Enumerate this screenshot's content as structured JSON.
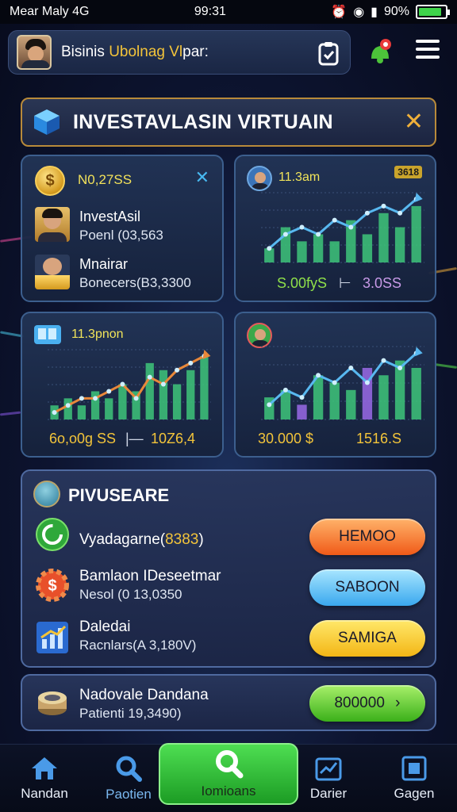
{
  "status_bar": {
    "carrier": "Mear Maly 4G",
    "time": "99:31",
    "battery": "90%"
  },
  "header": {
    "title_plain": "Bisinis ",
    "title_highlight": "Ubolnag Vl",
    "title_end": "par:"
  },
  "banner": {
    "title": "INVESTAVLASIN VIRTUAIN",
    "close": "✕"
  },
  "portfolio": {
    "coin_symbol": "$",
    "total": "N0,27SS",
    "close": "✕",
    "items": [
      {
        "name": "InvestAsil",
        "detail": "Poenl (03,563"
      },
      {
        "name": "Mnairar",
        "detail": "Bonecers(B3,3300"
      }
    ]
  },
  "chart1": {
    "label": "11.3am",
    "tag": "3618",
    "foot_left": "S.00fyS",
    "foot_sep": "⊢",
    "foot_right": "3.0SS",
    "colors": {
      "foot_left": "#8fe04a",
      "foot_right": "#c89ae8"
    },
    "chart_data": {
      "type": "bar",
      "values": [
        2,
        5,
        3,
        4,
        3,
        6,
        4,
        7,
        5,
        8
      ],
      "line": [
        2,
        4,
        5,
        4,
        6,
        5,
        7,
        8,
        7,
        9
      ]
    }
  },
  "chart2": {
    "label": "11.3pnon",
    "foot_left": "6o,o0g SS",
    "foot_sep": "|—",
    "foot_right": "10Z6,4",
    "colors": {
      "foot_left": "#f3c43a",
      "foot_right": "#f3c43a"
    },
    "chart_data": {
      "type": "bar",
      "values": [
        2,
        3,
        2,
        4,
        3,
        5,
        4,
        8,
        7,
        5,
        7,
        9
      ],
      "line": [
        1,
        2,
        3,
        3,
        4,
        5,
        3,
        6,
        5,
        7,
        8,
        9
      ]
    }
  },
  "chart3": {
    "foot_left": "30.000 $",
    "foot_right": "1516.S",
    "colors": {
      "foot_left": "#f3c43a",
      "foot_right": "#f3c43a"
    },
    "chart_data": {
      "type": "bar",
      "values": [
        3,
        4,
        2,
        6,
        5,
        4,
        7,
        6,
        8,
        7
      ],
      "line": [
        2,
        4,
        3,
        6,
        5,
        7,
        5,
        8,
        7,
        9
      ]
    }
  },
  "purchase": {
    "title": "PIVUSEARE",
    "rows": [
      {
        "name": "Vyadagarne(",
        "name_num": "8383",
        "name_end": ")",
        "detail": "",
        "button": "HEMOO",
        "button_color": "orange"
      },
      {
        "name": "Bamlaon IDeseetmar",
        "detail": "Nesol (0 13,0350",
        "button": "SABOON",
        "button_color": "blue"
      },
      {
        "name": "Daledai",
        "detail": "Racnlars(A 3,180V)",
        "button": "SAMIGA",
        "button_color": "yellow"
      }
    ]
  },
  "stash": {
    "name": "Nadovale Dandana",
    "detail": "Patienti 19,3490)",
    "button": "800000"
  },
  "nav": {
    "items": [
      {
        "label": "Nandan",
        "icon": "home-icon"
      },
      {
        "label": "Paotien",
        "icon": "search-icon"
      },
      {
        "label": "Iomioans",
        "icon": "search-icon"
      },
      {
        "label": "Darier",
        "icon": "chart-icon"
      },
      {
        "label": "Gagen",
        "icon": "window-icon"
      }
    ]
  }
}
